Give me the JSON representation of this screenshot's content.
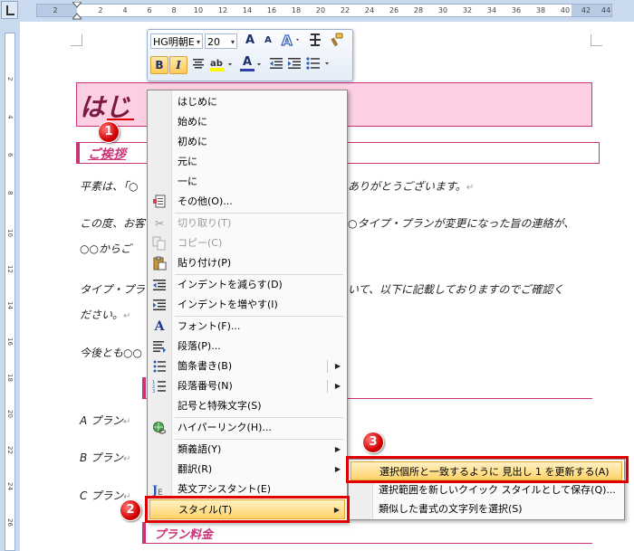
{
  "ruler": {
    "ticks": [
      "2",
      "2",
      "4",
      "6",
      "8",
      "10",
      "12",
      "14",
      "16",
      "18",
      "20",
      "22",
      "24",
      "26",
      "28",
      "30",
      "32",
      "34",
      "36",
      "38",
      "40",
      "42",
      "44"
    ],
    "left_ticks": [
      "2",
      "4",
      "6",
      "8",
      "10",
      "12",
      "14",
      "16",
      "18",
      "20",
      "22",
      "24",
      "26"
    ]
  },
  "mini_toolbar": {
    "font_name": "HG明朝E",
    "font_size": "20",
    "grow_font": "A",
    "shrink_font": "A",
    "bold": "B",
    "italic": "I",
    "font_color": "A"
  },
  "document": {
    "title": "はじ",
    "heading1": "ご挨拶",
    "para1": "平素は、「○",
    "para1_end": "ありがとうございます。",
    "para2": "この度、お客",
    "para2_end": "○タイプ・プランが変更になった旨の連絡が、",
    "para2b": "○○からご",
    "para3": "タイプ・プラ",
    "para3_end": "いて、以下に記載しておりますのでご確認く",
    "para3b": "ださい。",
    "para4": "今後とも○○",
    "plan_a": "A プラン",
    "plan_b": "B プラン",
    "plan_c": "C プラン",
    "heading2": "プラン料金",
    "pmark": "↵"
  },
  "context_menu": {
    "items": [
      {
        "label": "はじめに"
      },
      {
        "label": "始めに"
      },
      {
        "label": "初めに"
      },
      {
        "label": "元に"
      },
      {
        "label": "一に"
      },
      {
        "label": "その他(O)..."
      },
      {
        "label": "切り取り(T)"
      },
      {
        "label": "コピー(C)"
      },
      {
        "label": "貼り付け(P)"
      },
      {
        "label": "インデントを減らす(D)"
      },
      {
        "label": "インデントを増やす(I)"
      },
      {
        "label": "フォント(F)..."
      },
      {
        "label": "段落(P)..."
      },
      {
        "label": "箇条書き(B)"
      },
      {
        "label": "段落番号(N)"
      },
      {
        "label": "記号と特殊文字(S)"
      },
      {
        "label": "ハイパーリンク(H)..."
      },
      {
        "label": "類義語(Y)"
      },
      {
        "label": "翻訳(R)"
      },
      {
        "label": "英文アシスタント(E)"
      },
      {
        "label": "スタイル(T)"
      }
    ],
    "submenu_arrow": "▶"
  },
  "style_submenu": {
    "items": [
      {
        "label": "選択個所と一致するように 見出し 1 を更新する(A)"
      },
      {
        "label": "選択範囲を新しいクイック スタイルとして保存(Q)..."
      },
      {
        "label": "類似した書式の文字列を選択(S)"
      }
    ]
  },
  "callouts": [
    "1",
    "2",
    "3"
  ],
  "colors": {
    "title_fill": "#fccfe3",
    "accent": "#cc3377",
    "highlight": "#ffd36b",
    "callout": "#e00000"
  }
}
